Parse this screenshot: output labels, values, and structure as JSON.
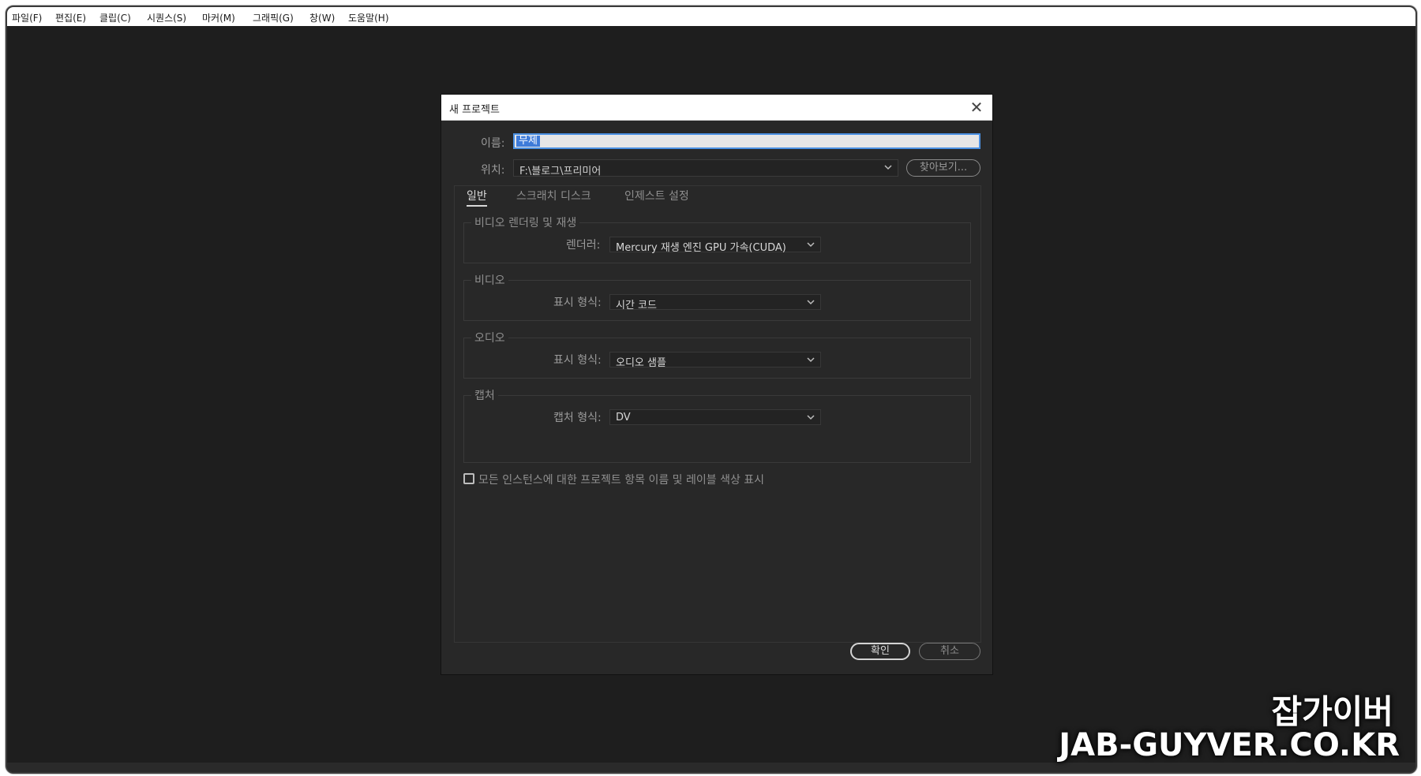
{
  "menubar": {
    "items": [
      "파일(F)",
      "편집(E)",
      "클립(C)",
      "시퀀스(S)",
      "마커(M)",
      "그래픽(G)",
      "창(W)",
      "도움말(H)"
    ]
  },
  "dialog": {
    "title": "새 프로젝트",
    "name_label": "이름:",
    "name_value": "무제",
    "location_label": "위치:",
    "location_value": "F:\\블로그\\프리미어",
    "browse_label": "찾아보기...",
    "tabs": [
      "일반",
      "스크래치 디스크",
      "인제스트 설정"
    ],
    "groups": {
      "render": {
        "title": "비디오 렌더링 및 재생",
        "field_label": "렌더러:",
        "value": "Mercury 재생 엔진 GPU 가속(CUDA)"
      },
      "video": {
        "title": "비디오",
        "field_label": "표시 형식:",
        "value": "시간 코드"
      },
      "audio": {
        "title": "오디오",
        "field_label": "표시 형식:",
        "value": "오디오 샘플"
      },
      "capture": {
        "title": "캡처",
        "field_label": "캡처 형식:",
        "value": "DV"
      }
    },
    "checkbox_label": "모든 인스턴스에 대한 프로젝트 항목 이름 및 레이블 색상 표시",
    "ok_label": "확인",
    "cancel_label": "취소",
    "close_glyph": "✕"
  },
  "watermark": {
    "korean": "잡가이버",
    "english": "JAB-GUYVER.CO.KR"
  }
}
